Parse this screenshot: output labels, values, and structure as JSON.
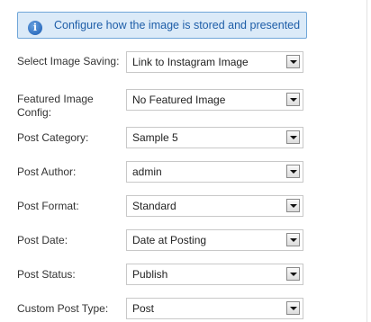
{
  "info_box": {
    "icon": "info-icon",
    "text": "Configure how the image is stored and presented"
  },
  "fields": [
    {
      "label": "Select Image Saving:",
      "value": "Link to Instagram Image"
    },
    {
      "label": "Featured Image Config:",
      "value": "No Featured Image"
    },
    {
      "label": "Post Category:",
      "value": "Sample 5"
    },
    {
      "label": "Post Author:",
      "value": "admin"
    },
    {
      "label": "Post Format:",
      "value": "Standard"
    },
    {
      "label": "Post Date:",
      "value": "Date at Posting"
    },
    {
      "label": "Post Status:",
      "value": "Publish"
    },
    {
      "label": "Custom Post Type:",
      "value": "Post"
    }
  ]
}
